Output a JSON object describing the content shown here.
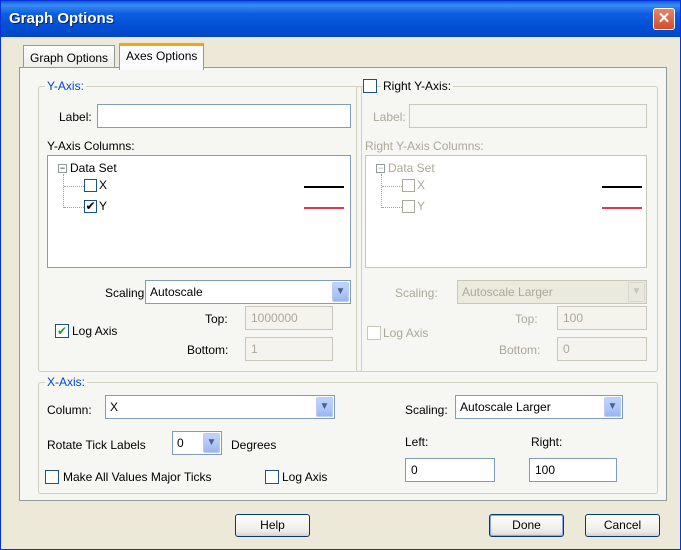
{
  "window": {
    "title": "Graph Options",
    "close_glyph": "✕"
  },
  "tabs": [
    {
      "label": "Graph Options",
      "active": false
    },
    {
      "label": "Axes Options",
      "active": true
    }
  ],
  "y_axis": {
    "group_title": "Y-Axis:",
    "label_caption": "Label:",
    "label_value": "",
    "columns_caption": "Y-Axis Columns:",
    "tree": {
      "root": "Data Set",
      "items": [
        {
          "name": "X",
          "checked": false,
          "line_color": "#000000"
        },
        {
          "name": "Y",
          "checked": true,
          "line_color": "#e03b4b"
        }
      ]
    },
    "scaling_caption": "Scaling:",
    "scaling_value": "Autoscale",
    "log_axis_label": "Log Axis",
    "log_axis_checked": true,
    "top_caption": "Top:",
    "top_value": "1000000",
    "bottom_caption": "Bottom:",
    "bottom_value": "1"
  },
  "right_y_axis": {
    "group_title": "Right Y-Axis:",
    "enabled": false,
    "label_caption": "Label:",
    "label_value": "",
    "columns_caption": "Right Y-Axis Columns:",
    "tree": {
      "root": "Data Set",
      "items": [
        {
          "name": "X",
          "checked": false,
          "line_color": "#000000"
        },
        {
          "name": "Y",
          "checked": false,
          "line_color": "#e03b4b"
        }
      ]
    },
    "scaling_caption": "Scaling:",
    "scaling_value": "Autoscale Larger",
    "log_axis_label": "Log Axis",
    "log_axis_checked": false,
    "top_caption": "Top:",
    "top_value": "100",
    "bottom_caption": "Bottom:",
    "bottom_value": "0"
  },
  "x_axis": {
    "group_title": "X-Axis:",
    "column_caption": "Column:",
    "column_value": "X",
    "rotate_caption": "Rotate Tick Labels",
    "rotate_value": "0",
    "degrees_caption": "Degrees",
    "major_ticks_label": "Make All Values Major Ticks",
    "major_ticks_checked": false,
    "log_axis_label": "Log Axis",
    "log_axis_checked": false,
    "scaling_caption": "Scaling:",
    "scaling_value": "Autoscale Larger",
    "left_caption": "Left:",
    "left_value": "0",
    "right_caption": "Right:",
    "right_value": "100"
  },
  "buttons": {
    "help": "Help",
    "done": "Done",
    "cancel": "Cancel"
  },
  "glyphs": {
    "check": "✔",
    "dropdown": "▼",
    "minus": "−"
  }
}
